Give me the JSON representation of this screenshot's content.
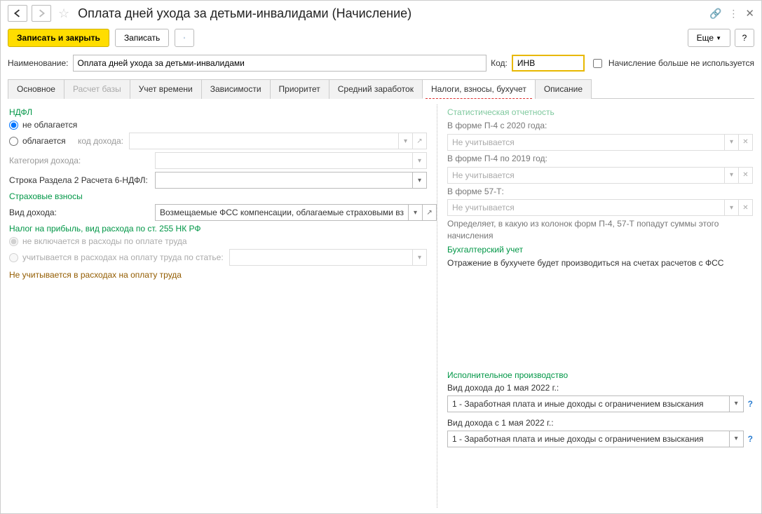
{
  "title": "Оплата дней ухода за детьми-инвалидами (Начисление)",
  "toolbar": {
    "save_close": "Записать и закрыть",
    "save": "Записать",
    "more": "Еще",
    "help": "?"
  },
  "header": {
    "name_label": "Наименование:",
    "name_value": "Оплата дней ухода за детьми-инвалидами",
    "code_label": "Код:",
    "code_value": "ИНВ",
    "unused_label": "Начисление больше не используется"
  },
  "tabs": {
    "t0": "Основное",
    "t1": "Расчет базы",
    "t2": "Учет времени",
    "t3": "Зависимости",
    "t4": "Приоритет",
    "t5": "Средний заработок",
    "t6": "Налоги, взносы, бухучет",
    "t7": "Описание"
  },
  "left": {
    "ndfl_title": "НДФЛ",
    "ndfl_not_taxed": "не облагается",
    "ndfl_taxed": "облагается",
    "income_code_label": "код дохода:",
    "income_category_label": "Категория дохода:",
    "section2_label": "Строка Раздела 2 Расчета 6-НДФЛ:",
    "insurance_title": "Страховые взносы",
    "income_type_label": "Вид дохода:",
    "income_type_value": "Возмещаемые ФСС компенсации, облагаемые страховыми вз",
    "profit_tax_title": "Налог на прибыль, вид расхода по ст. 255 НК РФ",
    "not_included": "не включается в расходы по оплате труда",
    "included_by_item": "учитывается в расходах на оплату труда по статье:",
    "not_counted_msg": "Не учитывается в расходах на оплату труда"
  },
  "right": {
    "stat_title": "Статистическая отчетность",
    "p4_2020_label": "В форме П-4 с 2020 года:",
    "p4_2019_label": "В форме П-4 по 2019 год:",
    "f57t_label": "В форме 57-Т:",
    "not_counted_placeholder": "Не учитывается",
    "stat_note": "Определяет, в какую из колонок форм П-4, 57-Т попадут суммы этого начисления",
    "acc_title": "Бухгалтерский учет",
    "acc_note": "Отражение в бухучете будет производиться на счетах расчетов с ФСС",
    "enforce_title": "Исполнительное производство",
    "income_before_label": "Вид дохода до 1 мая 2022 г.:",
    "income_after_label": "Вид дохода с 1 мая 2022 г.:",
    "income_value": "1 - Заработная плата и иные доходы с ограничением взыскания"
  }
}
